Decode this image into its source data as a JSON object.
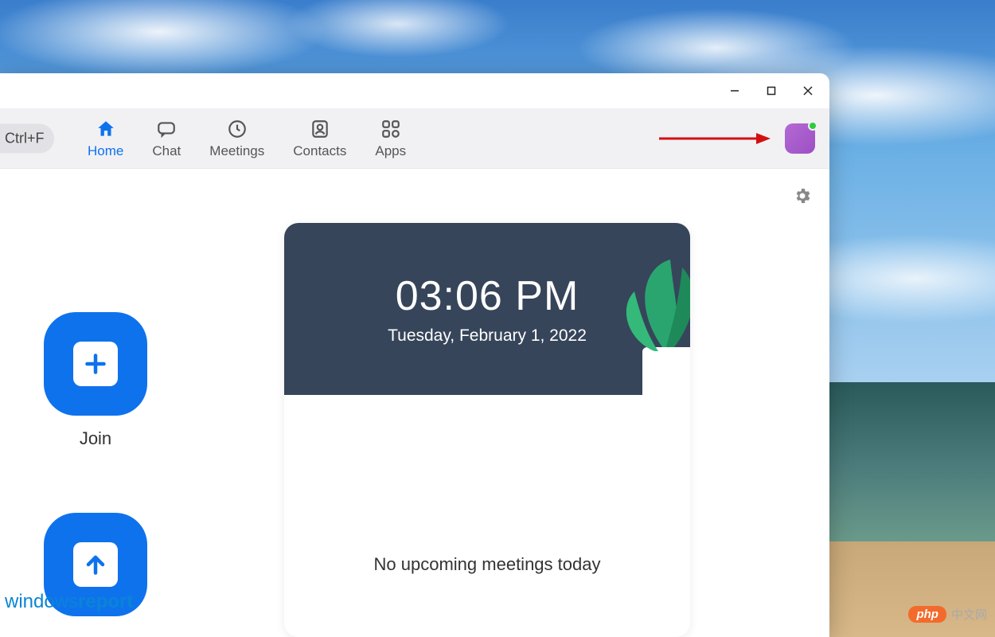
{
  "shortcut_hint": "Ctrl+F",
  "nav": {
    "tabs": [
      {
        "label": "Home",
        "active": true,
        "icon": "home-icon"
      },
      {
        "label": "Chat",
        "active": false,
        "icon": "chat-icon"
      },
      {
        "label": "Meetings",
        "active": false,
        "icon": "clock-icon"
      },
      {
        "label": "Contacts",
        "active": false,
        "icon": "contacts-icon"
      },
      {
        "label": "Apps",
        "active": false,
        "icon": "apps-icon"
      }
    ]
  },
  "avatar": {
    "status": "online",
    "color": "#9c4fc4"
  },
  "clock": {
    "time": "03:06 PM",
    "date": "Tuesday, February 1, 2022"
  },
  "main": {
    "no_meetings_text": "No upcoming meetings today"
  },
  "actions": {
    "join_label": "Join"
  },
  "watermarks": {
    "left_prefix": "windows",
    "left_suffix": "report",
    "right_badge": "php",
    "right_text": "中文网"
  },
  "colors": {
    "accent": "#0e72ed",
    "annotation_arrow": "#d40f0f"
  }
}
